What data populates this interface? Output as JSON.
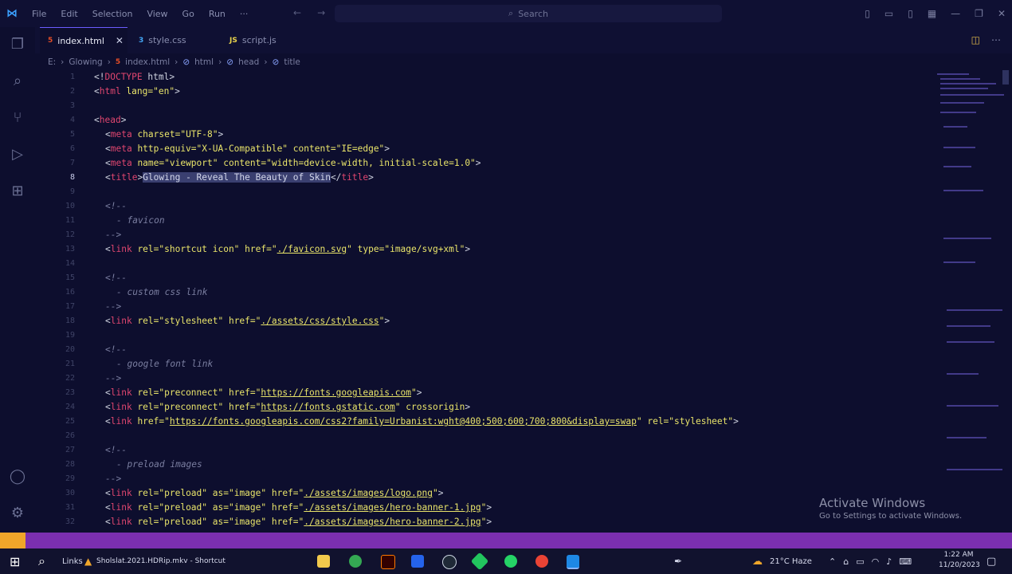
{
  "titlebar": {
    "menu": [
      "File",
      "Edit",
      "Selection",
      "View",
      "Go",
      "Run",
      "···"
    ],
    "search_placeholder": "Search"
  },
  "tabs": [
    {
      "label": "index.html",
      "active": true
    },
    {
      "label": "style.css",
      "active": false
    },
    {
      "label": "script.js",
      "active": false
    }
  ],
  "breadcrumb": [
    "E:",
    "Glowing",
    "index.html",
    "html",
    "head",
    "title"
  ],
  "code_lines": [
    {
      "n": "1"
    },
    {
      "n": "2"
    },
    {
      "n": "3"
    },
    {
      "n": "4"
    },
    {
      "n": "5"
    },
    {
      "n": "6"
    },
    {
      "n": "7"
    },
    {
      "n": "8"
    },
    {
      "n": "9"
    },
    {
      "n": "10"
    },
    {
      "n": "11"
    },
    {
      "n": "12"
    },
    {
      "n": "13"
    },
    {
      "n": "14"
    },
    {
      "n": "15"
    },
    {
      "n": "16"
    },
    {
      "n": "17"
    },
    {
      "n": "18"
    },
    {
      "n": "19"
    },
    {
      "n": "20"
    },
    {
      "n": "21"
    },
    {
      "n": "22"
    },
    {
      "n": "23"
    },
    {
      "n": "24"
    },
    {
      "n": "25"
    },
    {
      "n": "26"
    },
    {
      "n": "27"
    },
    {
      "n": "28"
    },
    {
      "n": "29"
    },
    {
      "n": "30"
    },
    {
      "n": "31"
    },
    {
      "n": "32"
    }
  ],
  "code": {
    "l1": {
      "tag": "DOCTYPE",
      "rest": " html"
    },
    "l2": {
      "tag": "html",
      "attr": " lang=",
      "val": "\"en\""
    },
    "l4": {
      "tag": "head"
    },
    "l5": {
      "tag": "meta",
      "attr": " charset=",
      "val": "\"UTF-8\""
    },
    "l6": {
      "tag": "meta",
      "attr1": " http-equiv=",
      "val1": "\"X-UA-Compatible\"",
      "attr2": " content=",
      "val2": "\"IE=edge\""
    },
    "l7": {
      "tag": "meta",
      "attr1": " name=",
      "val1": "\"viewport\"",
      "attr2": " content=",
      "val2": "\"width=device-width, initial-scale=1.0\""
    },
    "l8": {
      "tag": "title",
      "text": "Glowing - Reveal The Beauty of Skin"
    },
    "c_open": "<!--",
    "c_close": "-->",
    "c_favicon": "- favicon",
    "l13": {
      "tag": "link",
      "attr1": " rel=",
      "val1": "\"shortcut icon\"",
      "attr2": " href=",
      "val2": "./favicon.svg",
      "attr3": " type=",
      "val3": "\"image/svg+xml\""
    },
    "c_css": "- custom css link",
    "l18": {
      "tag": "link",
      "attr1": " rel=",
      "val1": "\"stylesheet\"",
      "attr2": " href=",
      "val2": "./assets/css/style.css"
    },
    "c_font": "- google font link",
    "l23": {
      "tag": "link",
      "attr1": " rel=",
      "val1": "\"preconnect\"",
      "attr2": " href=",
      "val2": "https://fonts.googleapis.com"
    },
    "l24": {
      "tag": "link",
      "attr1": " rel=",
      "val1": "\"preconnect\"",
      "attr2": " href=",
      "val2": "https://fonts.gstatic.com",
      "attr3": " crossorigin"
    },
    "l25": {
      "tag": "link",
      "attr2": " href=",
      "val2": "https://fonts.googleapis.com/css2?family=Urbanist:wght@400;500;600;700;800&display=swap",
      "attr3": " rel=",
      "val3": "\"stylesheet\""
    },
    "c_images": "- preload images",
    "l30": {
      "tag": "link",
      "attr1": " rel=",
      "val1": "\"preload\"",
      "attr2": " as=",
      "val2": "\"image\"",
      "attr3": " href=",
      "val3": "./assets/images/logo.png"
    },
    "l31": {
      "tag": "link",
      "attr1": " rel=",
      "val1": "\"preload\"",
      "attr2": " as=",
      "val2": "\"image\"",
      "attr3": " href=",
      "val3": "./assets/images/hero-banner-1.jpg"
    },
    "l32": {
      "tag": "link",
      "attr1": " rel=",
      "val1": "\"preload\"",
      "attr2": " as=",
      "val2": "\"image\"",
      "attr3": " href=",
      "val3": "./assets/images/hero-banner-2.jpg"
    }
  },
  "watermark": {
    "title": "Activate Windows",
    "subtitle": "Go to Settings to activate Windows."
  },
  "taskbar": {
    "links_label": "Links",
    "window_label": "Sholslat.2021.HDRip.mkv - Shortcut",
    "weather": "21°C  Haze",
    "time": "1:22 AM",
    "date": "11/20/2023"
  },
  "colors": {
    "tag": "#e0466f",
    "attr": "#e9e46a",
    "status_bar": "#7b2fb0",
    "accent": "#6b5cff"
  }
}
